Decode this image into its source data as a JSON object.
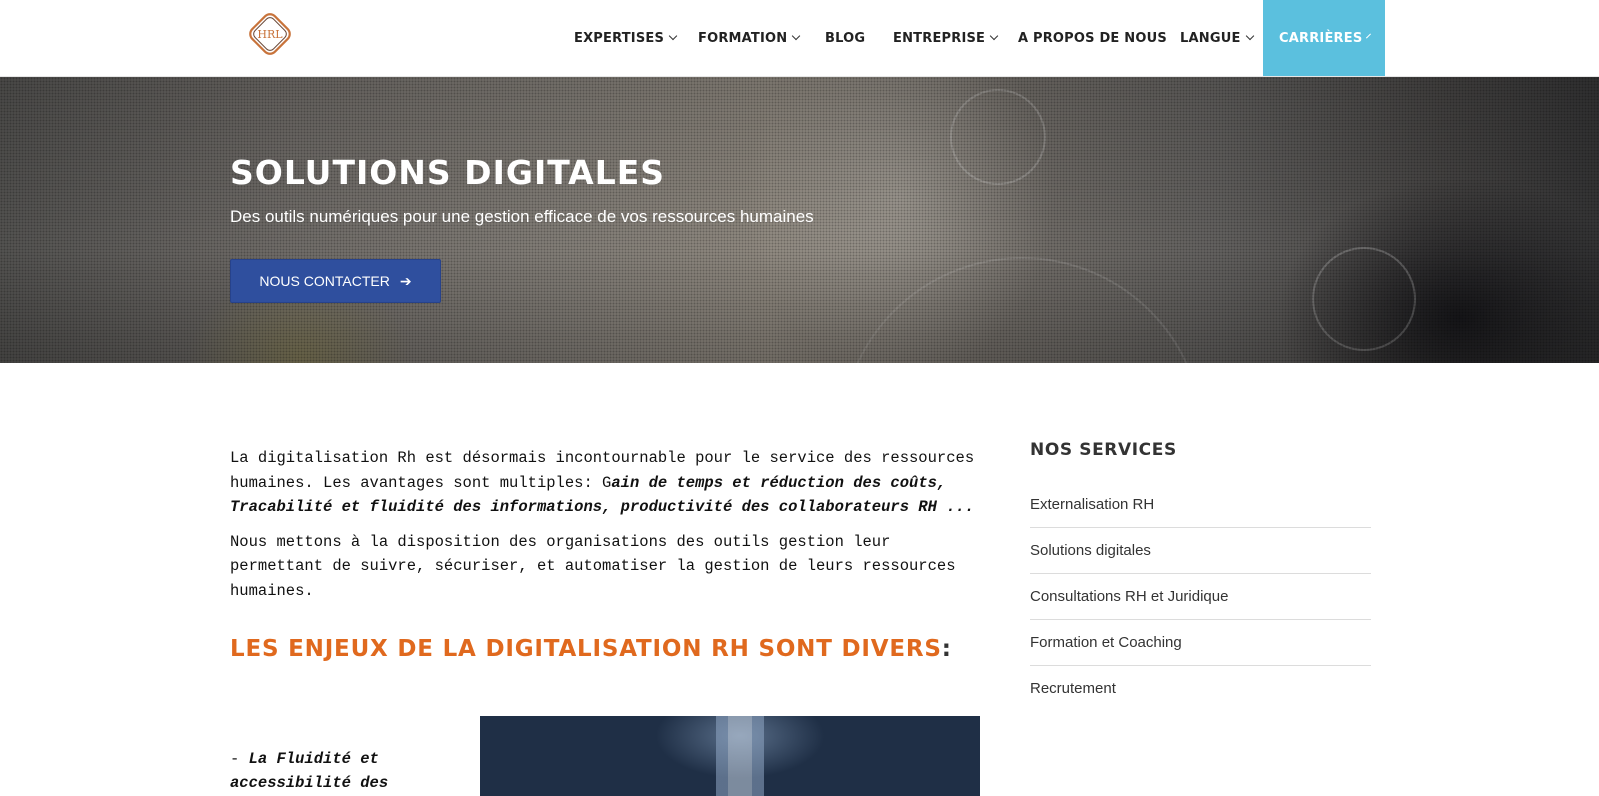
{
  "header": {
    "logo_icon": "hrl-logo-icon",
    "nav": [
      {
        "label": "EXPERTISES",
        "has_dropdown": true
      },
      {
        "label": "FORMATION",
        "has_dropdown": true
      },
      {
        "label": "BLOG",
        "has_dropdown": false
      },
      {
        "label": "ENTREPRISE",
        "has_dropdown": true
      },
      {
        "label": "A PROPOS DE NOUS",
        "has_dropdown": false
      },
      {
        "label": "LANGUE",
        "has_dropdown": true
      }
    ],
    "cta": {
      "label": "CARRIÈRES",
      "has_dropdown": true
    }
  },
  "hero": {
    "title": "SOLUTIONS DIGITALES",
    "subtitle": "Des outils numériques pour une gestion efficace de vos ressources humaines",
    "button_label": "NOUS CONTACTER",
    "button_icon": "arrow-right-icon"
  },
  "content": {
    "p1_plain": "La digitalisation Rh est désormais incontournable pour le service des ressources humaines. Les avantages sont multiples: G",
    "p1_emph": "ain de temps et réduction des coûts, Tracabilité et fluidité des informations, productivité des collaborateurs RH ...",
    "p2": "Nous mettons à la disposition des organisations des outils gestion  leur permettant de suivre, sécuriser, et automatiser la gestion de leurs ressources humaines.",
    "section_title": "LES ENJEUX DE LA DIGITALISATION RH SONT DIVERS",
    "section_colon": ":",
    "bullet_dash": "- ",
    "bullet_text": "La Fluidité et accessibilité des"
  },
  "sidebar": {
    "title": "NOS SERVICES",
    "items": [
      "Externalisation RH",
      "Solutions digitales",
      "Consultations RH et Juridique",
      "Formation et Coaching",
      "Recrutement"
    ]
  },
  "colors": {
    "accent": "#5bc0de",
    "button": "#2f4f9e",
    "section_title": "#e0691e"
  }
}
